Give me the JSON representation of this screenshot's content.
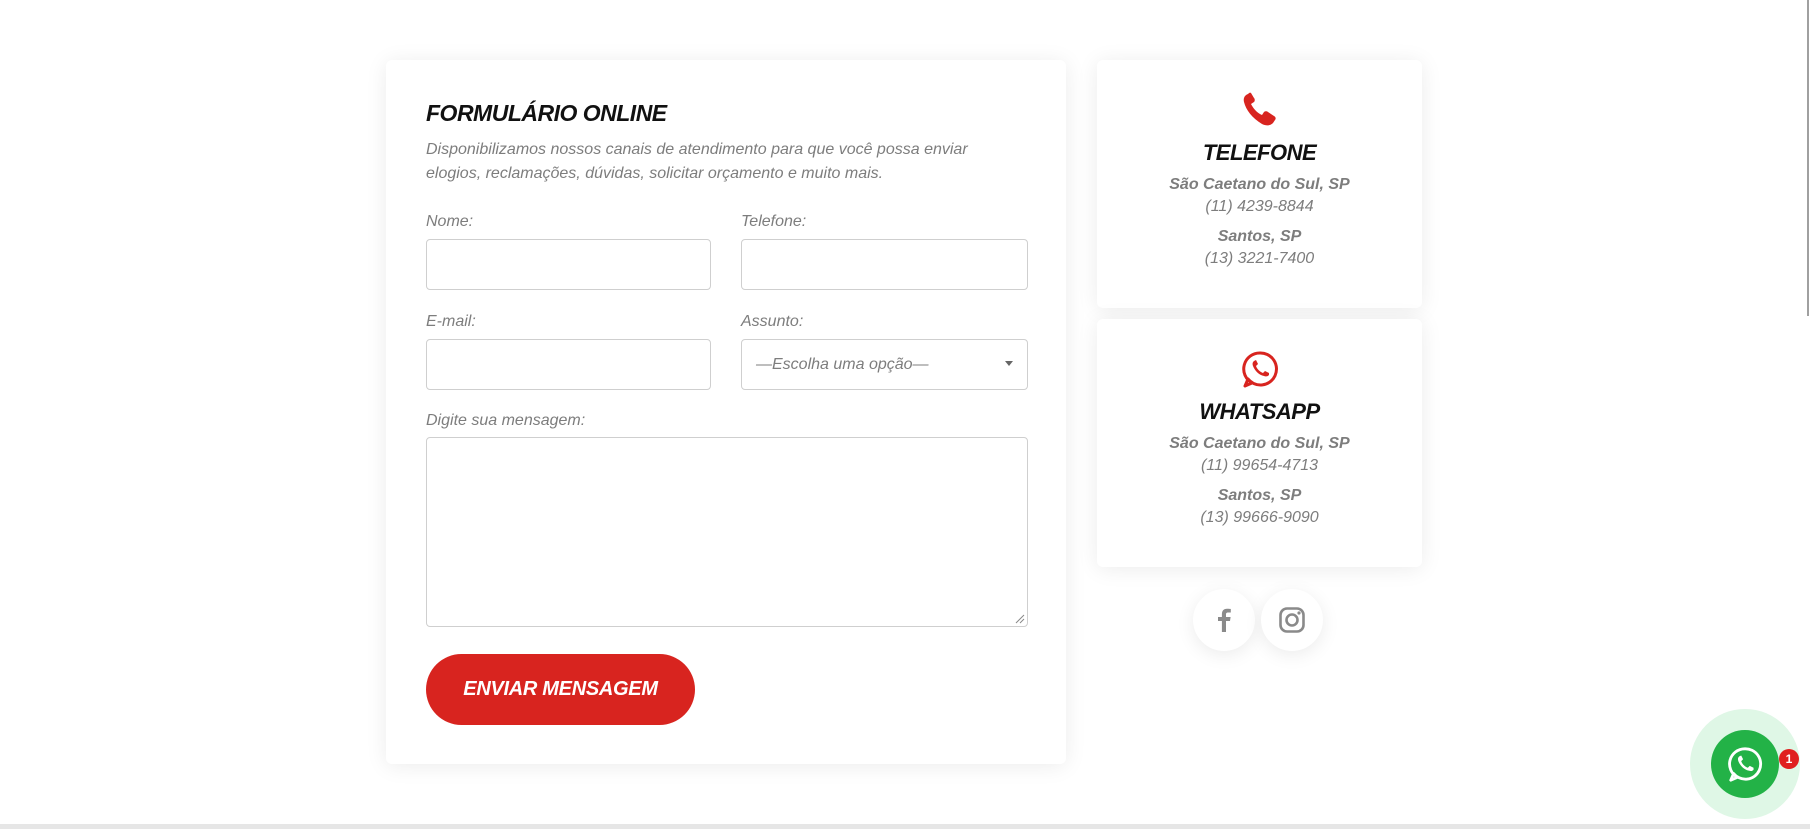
{
  "form": {
    "title": "FORMULÁRIO ONLINE",
    "description": "Disponibilizamos nossos canais de atendimento para que você possa enviar elogios, reclamações, dúvidas, solicitar orçamento e muito mais.",
    "name_label": "Nome:",
    "phone_label": "Telefone:",
    "email_label": "E-mail:",
    "subject_label": "Assunto:",
    "subject_selected": "—Escolha uma opção—",
    "message_label": "Digite sua mensagem:",
    "submit_label": "ENVIAR MENSAGEM"
  },
  "telefone": {
    "icon": "phone-icon",
    "title": "TELEFONE",
    "locations": [
      {
        "city": "São Caetano do Sul, SP",
        "number": "(11) 4239-8844"
      },
      {
        "city": "Santos, SP",
        "number": "(13) 3221-7400"
      }
    ]
  },
  "whatsapp": {
    "icon": "whatsapp-icon",
    "title": "WHATSAPP",
    "locations": [
      {
        "city": "São Caetano do Sul, SP",
        "number": "(11) 99654-4713"
      },
      {
        "city": "Santos, SP",
        "number": "(13) 99666-9090"
      }
    ]
  },
  "social": {
    "items": [
      "facebook-icon",
      "instagram-icon"
    ]
  },
  "floating_whatsapp": {
    "badge": "1"
  },
  "colors": {
    "accent_red": "#d8241f",
    "whatsapp_green": "#23b247",
    "text_gray": "#7d7d7d",
    "heading": "#111111"
  }
}
